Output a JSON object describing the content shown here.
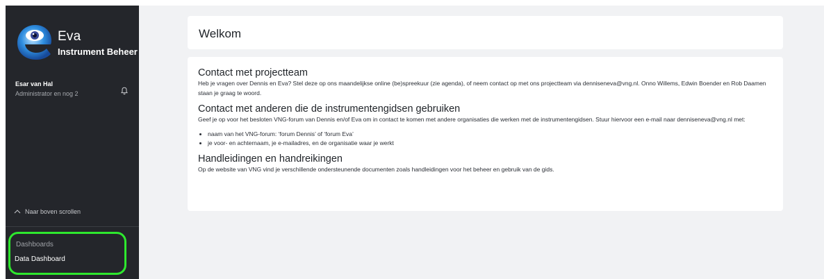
{
  "sidebar": {
    "app_name": "Eva",
    "app_subtitle": "Instrument Beheer",
    "user": {
      "name": "Esar van Hal",
      "role": "Administrator en nog 2"
    },
    "scroll_top_label": "Naar boven scrollen",
    "dashboards": {
      "heading": "Dashboards",
      "items": [
        {
          "label": "Data Dashboard"
        }
      ]
    },
    "highlight_color": "#2ee82e"
  },
  "main": {
    "welcome_title": "Welkom",
    "sections": [
      {
        "title": "Contact met projectteam",
        "body": "Heb je vragen over Dennis en Eva? Stel deze op ons maandelijkse online (be)spreekuur (zie agenda), of neem contact op met ons projectteam via denniseneva@vng.nl. Onno Willems, Edwin Boender en Rob Daamen staan je graag te woord."
      },
      {
        "title": "Contact met anderen die de instrumentengidsen gebruiken",
        "body": "Geef je op voor het besloten VNG-forum van Dennis en/of Eva om in contact te komen met andere organisaties die werken met de instrumentengidsen. Stuur hiervoor een e-mail naar denniseneva@vng.nl met:",
        "bullets": [
          "naam van het VNG-forum: ‘forum Dennis’ of ‘forum Eva’",
          "je voor- en achternaam, je e-mailadres, en de organisatie waar je werkt"
        ]
      },
      {
        "title": "Handleidingen en handreikingen",
        "body": "Op de website van VNG vind je verschillende ondersteunende documenten zoals handleidingen voor het beheer en gebruik van de gids."
      }
    ]
  },
  "icons": {
    "logo": "eva-logo-icon",
    "bell": "bell-icon",
    "scroll": "chevron-up-icon"
  },
  "colors": {
    "sidebar_bg": "#24262b",
    "main_bg": "#f1f2f4",
    "card_bg": "#ffffff"
  }
}
